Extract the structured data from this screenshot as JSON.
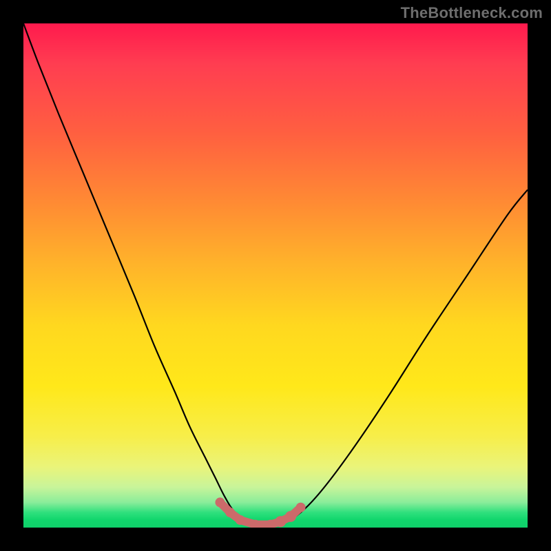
{
  "watermark": "TheBottleneck.com",
  "colors": {
    "page_bg": "#000000",
    "curve": "#000000",
    "accent": "#cc6a6a",
    "watermark": "#6e6e6e"
  },
  "chart_data": {
    "type": "line",
    "title": "",
    "xlabel": "",
    "ylabel": "",
    "xlim": [
      0,
      100
    ],
    "ylim": [
      0,
      100
    ],
    "grid": false,
    "legend": false,
    "series": [
      {
        "name": "bottleneck-curve",
        "x": [
          0,
          3,
          7,
          12,
          17,
          22,
          26,
          30,
          33,
          36,
          38,
          40,
          42,
          45,
          48,
          50,
          52,
          55,
          58,
          62,
          67,
          73,
          80,
          88,
          96,
          100
        ],
        "y": [
          100,
          92,
          82,
          70,
          58,
          46,
          36,
          27,
          20,
          14,
          10,
          6,
          3,
          1,
          0.5,
          0.5,
          1,
          3,
          6,
          11,
          18,
          27,
          38,
          50,
          62,
          67
        ]
      }
    ],
    "accent_points": {
      "name": "low-bottleneck-band",
      "x": [
        39,
        41,
        43,
        46,
        49,
        51,
        53,
        55
      ],
      "y": [
        5,
        3,
        1.5,
        0.6,
        0.6,
        1.2,
        2.2,
        4
      ]
    },
    "gradient_stops": [
      {
        "pos": 0,
        "color": "#ff1a4d"
      },
      {
        "pos": 0.22,
        "color": "#ff6040"
      },
      {
        "pos": 0.48,
        "color": "#ffb42a"
      },
      {
        "pos": 0.72,
        "color": "#ffe81a"
      },
      {
        "pos": 0.95,
        "color": "#8aed9a"
      },
      {
        "pos": 1.0,
        "color": "#0fd06a"
      }
    ]
  }
}
